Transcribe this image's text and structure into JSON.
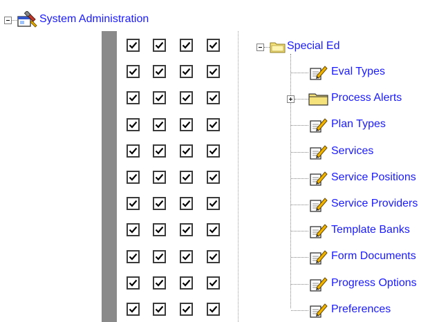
{
  "tree": {
    "root": {
      "label": "System Administration",
      "icon": "admin-tools-icon"
    },
    "folder": {
      "label": "Special Ed",
      "icon": "folder-open-icon"
    },
    "items": [
      {
        "label": "Eval Types",
        "icon": "edit-document-icon",
        "expander": false
      },
      {
        "label": "Process Alerts",
        "icon": "folder-icon",
        "expander": true
      },
      {
        "label": "Plan Types",
        "icon": "edit-document-icon",
        "expander": false
      },
      {
        "label": "Services",
        "icon": "edit-document-icon",
        "expander": false
      },
      {
        "label": "Service Positions",
        "icon": "edit-document-icon",
        "expander": false
      },
      {
        "label": "Service Providers",
        "icon": "edit-document-icon",
        "expander": false
      },
      {
        "label": "Template Banks",
        "icon": "edit-document-icon",
        "expander": false
      },
      {
        "label": "Form Documents",
        "icon": "edit-document-icon",
        "expander": false
      },
      {
        "label": "Progress Options",
        "icon": "edit-document-icon",
        "expander": false
      },
      {
        "label": "Preferences",
        "icon": "edit-document-icon",
        "expander": false
      }
    ]
  },
  "permissions": {
    "columns": 4,
    "rows": [
      [
        true,
        true,
        true,
        true
      ],
      [
        true,
        true,
        true,
        true
      ],
      [
        true,
        true,
        true,
        true
      ],
      [
        true,
        true,
        true,
        true
      ],
      [
        true,
        true,
        true,
        true
      ],
      [
        true,
        true,
        true,
        true
      ],
      [
        true,
        true,
        true,
        true
      ],
      [
        true,
        true,
        true,
        true
      ],
      [
        true,
        true,
        true,
        true
      ],
      [
        true,
        true,
        true,
        true
      ],
      [
        true,
        true,
        true,
        true
      ]
    ]
  },
  "colors": {
    "link": "#1a1aff",
    "strip": "#8a8a8a",
    "folder": "#f5e27a"
  }
}
